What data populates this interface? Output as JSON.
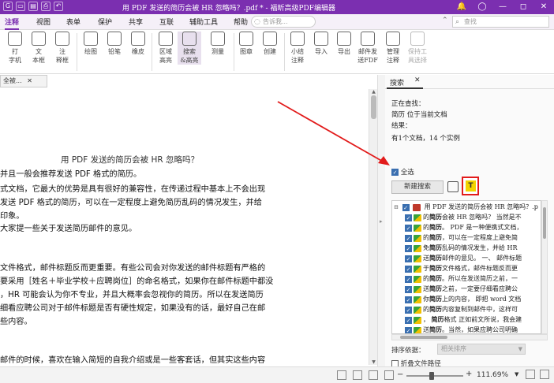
{
  "window": {
    "title": "用 PDF 发送的简历会被 HR 忽略吗？.pdf * - 福昕高级PDF编辑器",
    "controls": [
      "—",
      "◻",
      "✕"
    ]
  },
  "menu": {
    "tabs": [
      "注释",
      "视图",
      "表单",
      "保护",
      "共享",
      "互联",
      "辅助工具",
      "帮助"
    ],
    "active_tab": "注释",
    "tell_me": "告诉我...",
    "find_placeholder": "查找"
  },
  "ribbon": {
    "buttons": [
      {
        "label": "打\n字机"
      },
      {
        "label": "文\n本框"
      },
      {
        "label": "注\n释框"
      },
      {
        "label": "绘图"
      },
      {
        "label": "铅笔"
      },
      {
        "label": "橡皮"
      },
      {
        "label": "区域\n高亮"
      },
      {
        "label": "搜索\n&高亮"
      },
      {
        "label": "测量"
      },
      {
        "label": "图章"
      },
      {
        "label": "创建"
      },
      {
        "label": "小结\n注释"
      },
      {
        "label": "导入"
      },
      {
        "label": "导出"
      },
      {
        "label": "邮件发\n送FDF"
      },
      {
        "label": "管理\n注释"
      },
      {
        "label": "保持工\n具选择"
      }
    ]
  },
  "document": {
    "tab_label": "全被...",
    "heading": "用 PDF 发送的简历会被 HR 忽略吗？",
    "lines": [
      "并且一般会推荐发送 PDF 格式的简历。",
      "式文档，它最大的优势是具有很好的兼容性，在传递过程中基本上不会出现",
      "发送 PDF 格式的简历，可以在一定程度上避免简历乱码的情况发生，并给",
      "印象。",
      "大家提一些关于发送简历邮件的意见。",
      "文件格式，邮件标题反而更重要。有些公司会对你发送的邮件标题有严格的",
      "要采用［姓名＋毕业学校＋应聘岗位］的命名格式，如果你在邮件标题中都没",
      "，HR 可能会认为你不专业，并且大概率会忽视你的简历。所以在发送简历",
      "细看应聘公司对于邮件标题是否有硬性规定，如果没有的话，最好自己在邮",
      "些内容。",
      "邮件的时候，喜欢在输入简短的自我介绍或是一些客套话，但其实这些内容"
    ]
  },
  "search_panel": {
    "tab": "搜索",
    "close": "✕",
    "searching_label": "正在查找：",
    "query_line": "简历 位于当前文档",
    "result_label": "结果：",
    "summary": "有1个文档，14 个实例",
    "select_all": "全选",
    "new_search": "新建搜索",
    "highlight_icon": "T",
    "results": [
      {
        "text": "用 PDF 发送的简历会被 HR 忽略吗？.p",
        "type": "file"
      },
      {
        "pre": "的",
        "hit": "简历",
        "post": "会被 HR 忽略吗？ 当然是不"
      },
      {
        "pre": "的",
        "hit": "简历",
        "post": "。 PDF 是一种便携式文档，"
      },
      {
        "pre": "的",
        "hit": "简历",
        "post": "，可以在一定程度上避免简"
      },
      {
        "pre": "免",
        "hit": "简历",
        "post": "乱码的情况发生，并给 HR"
      },
      {
        "pre": "送",
        "hit": "简历",
        "post": "邮件的意见。 一、 邮件标题"
      },
      {
        "pre": "于",
        "hit": "简历",
        "post": "文件格式，邮件标题反而更"
      },
      {
        "pre": "的",
        "hit": "简历",
        "post": "。所以在发送简历之前，一"
      },
      {
        "pre": "送",
        "hit": "简历",
        "post": "之前，一定要仔细看应聘公"
      },
      {
        "pre": "你",
        "hit": "简历",
        "post": "上的内容， 即把 word 文档"
      },
      {
        "pre": "的",
        "hit": "简历",
        "post": "内容复制到邮件中，这样可"
      },
      {
        "pre": "， ",
        "hit": "简历",
        "post": "格式 正如前文所说，我会建"
      },
      {
        "pre": "送",
        "hit": "简历",
        "post": "。当然，如果应聘公司明确"
      }
    ],
    "sort_label": "排序依据：",
    "sort_value": "相关排序",
    "collapse_label": "折叠文件路径"
  },
  "statusbar": {
    "zoom": "111.69%"
  },
  "colors": {
    "brand": "#7b2fb0",
    "highlight_border": "#e21b1b",
    "highlight_fill": "#f3d400",
    "checkbox": "#3a6fb0"
  }
}
